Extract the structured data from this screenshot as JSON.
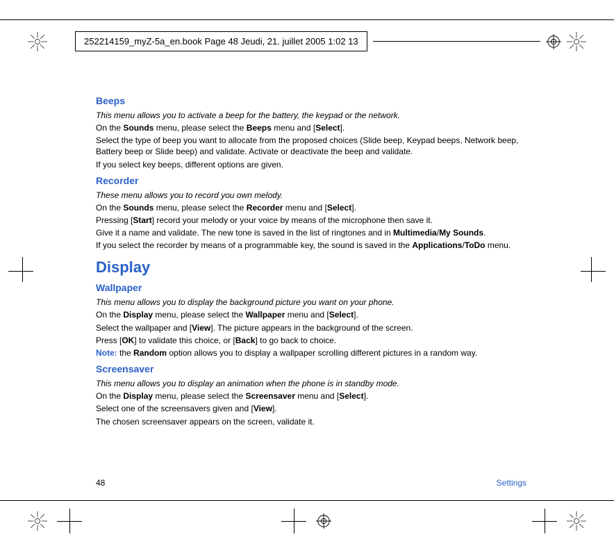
{
  "header": {
    "stamp": "252214159_myZ-5a_en.book  Page 48  Jeudi, 21. juillet 2005  1:02 13"
  },
  "sections": {
    "beeps": {
      "title": "Beeps",
      "intro": "This menu allows you to activate a beep for the battery, the keypad or the network.",
      "l1a": "On the ",
      "l1b": "Sounds",
      "l1c": " menu, please select the ",
      "l1d": "Beeps",
      "l1e": " menu and [",
      "l1f": "Select",
      "l1g": "].",
      "l2": "Select the type of beep you want to allocate from the proposed choices (Slide beep, Keypad beeps, Network beep, Battery beep or Slide beep) and validate. Activate or deactivate the beep and validate.",
      "l3": "If you select key beeps, different options are given."
    },
    "recorder": {
      "title": "Recorder",
      "intro": "These menu allows you to record you own melody.",
      "l1a": "On the ",
      "l1b": "Sounds",
      "l1c": " menu, please select the ",
      "l1d": "Recorder",
      "l1e": " menu and [",
      "l1f": "Select",
      "l1g": "].",
      "l2a": "Pressing [",
      "l2b": "Start",
      "l2c": "] record your melody or your voice by means of the microphone then save it.",
      "l3a": "Give it a name and validate. The new tone is saved in the list of ringtones and in ",
      "l3b": "Multimedia",
      "l3c": "/",
      "l3d": "My Sounds",
      "l3e": ".",
      "l4a": "If you select the recorder by means of a programmable key, the sound is saved in the ",
      "l4b": "Applications",
      "l4c": "/",
      "l4d": "ToDo",
      "l4e": " menu."
    },
    "display": {
      "title": "Display"
    },
    "wallpaper": {
      "title": "Wallpaper",
      "intro": "This menu allows you to display the background picture you want on your phone.",
      "l1a": "On the ",
      "l1b": "Display",
      "l1c": " menu, please select the ",
      "l1d": "Wallpaper",
      "l1e": " menu and [",
      "l1f": "Select",
      "l1g": "].",
      "l2a": "Select the wallpaper and [",
      "l2b": "View",
      "l2c": "]. The picture appears in the background of the screen.",
      "l3a": "Press [",
      "l3b": "OK",
      "l3c": "] to validate this choice, or [",
      "l3d": "Back",
      "l3e": "] to go back to choice.",
      "l4a": "Note:",
      "l4b": " the ",
      "l4c": "Random",
      "l4d": " option allows you to display a wallpaper scrolling different pictures in a random way."
    },
    "screensaver": {
      "title": "Screensaver",
      "intro": "This menu allows you to display an animation when the phone is in standby mode.",
      "l1a": "On the ",
      "l1b": "Display",
      "l1c": " menu, please select the ",
      "l1d": "Screensaver",
      "l1e": " menu and [",
      "l1f": "Select",
      "l1g": "].",
      "l2a": "Select one of the screensavers given and [",
      "l2b": "View",
      "l2c": "].",
      "l3": "The chosen screensaver appears on the screen, validate it."
    }
  },
  "footer": {
    "page": "48",
    "label": "Settings"
  }
}
